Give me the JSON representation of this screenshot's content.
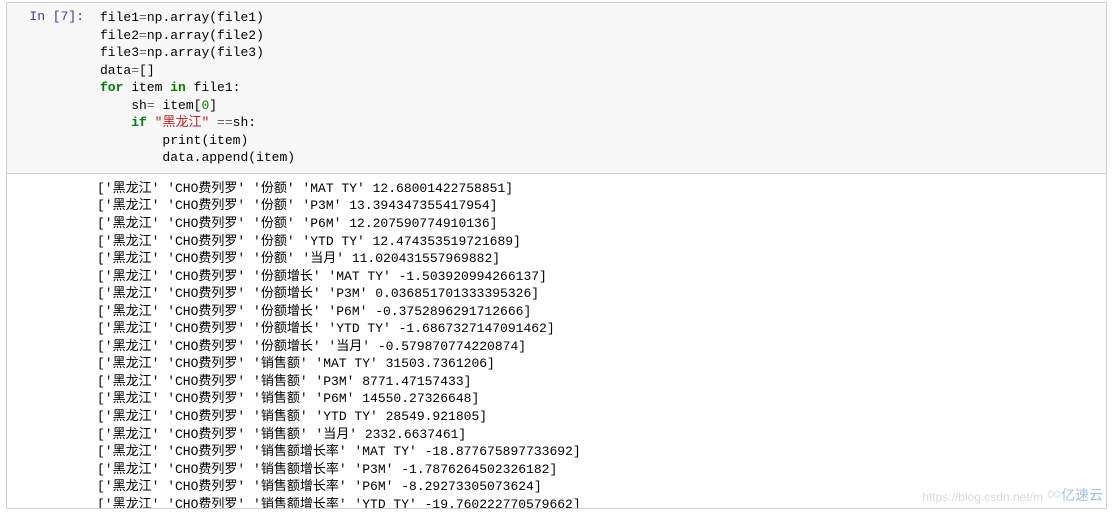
{
  "cell": {
    "prompt_label": "In  [7]:",
    "code_lines": [
      {
        "tokens": [
          {
            "t": "file1",
            "c": "var"
          },
          {
            "t": "=",
            "c": "op"
          },
          {
            "t": "np",
            "c": "var"
          },
          {
            "t": ".",
            "c": "var"
          },
          {
            "t": "array",
            "c": "var"
          },
          {
            "t": "(",
            "c": "paren"
          },
          {
            "t": "file1",
            "c": "var"
          },
          {
            "t": ")",
            "c": "paren"
          }
        ],
        "indent": 0
      },
      {
        "tokens": [
          {
            "t": "file2",
            "c": "var"
          },
          {
            "t": "=",
            "c": "op"
          },
          {
            "t": "np",
            "c": "var"
          },
          {
            "t": ".",
            "c": "var"
          },
          {
            "t": "array",
            "c": "var"
          },
          {
            "t": "(",
            "c": "paren"
          },
          {
            "t": "file2",
            "c": "var"
          },
          {
            "t": ")",
            "c": "paren"
          }
        ],
        "indent": 0
      },
      {
        "tokens": [
          {
            "t": "file3",
            "c": "var"
          },
          {
            "t": "=",
            "c": "op"
          },
          {
            "t": "np",
            "c": "var"
          },
          {
            "t": ".",
            "c": "var"
          },
          {
            "t": "array",
            "c": "var"
          },
          {
            "t": "(",
            "c": "paren"
          },
          {
            "t": "file3",
            "c": "var"
          },
          {
            "t": ")",
            "c": "paren"
          }
        ],
        "indent": 0
      },
      {
        "tokens": [
          {
            "t": "data",
            "c": "var"
          },
          {
            "t": "=",
            "c": "op"
          },
          {
            "t": "[]",
            "c": "paren"
          }
        ],
        "indent": 0
      },
      {
        "tokens": [
          {
            "t": "for",
            "c": "kw-green"
          },
          {
            "t": " item ",
            "c": "var"
          },
          {
            "t": "in",
            "c": "kw-green"
          },
          {
            "t": " file1:",
            "c": "var"
          }
        ],
        "indent": 0
      },
      {
        "tokens": [
          {
            "t": "sh",
            "c": "var"
          },
          {
            "t": "= ",
            "c": "op"
          },
          {
            "t": "item",
            "c": "var"
          },
          {
            "t": "[",
            "c": "paren"
          },
          {
            "t": "0",
            "c": "num"
          },
          {
            "t": "]",
            "c": "paren"
          }
        ],
        "indent": 1
      },
      {
        "tokens": [
          {
            "t": "if",
            "c": "kw-green"
          },
          {
            "t": " ",
            "c": "var"
          },
          {
            "t": "\"黑龙江\"",
            "c": "kw-red"
          },
          {
            "t": " ==",
            "c": "op"
          },
          {
            "t": "sh:",
            "c": "var"
          }
        ],
        "indent": 1
      },
      {
        "tokens": [
          {
            "t": "print",
            "c": "var"
          },
          {
            "t": "(",
            "c": "paren"
          },
          {
            "t": "item",
            "c": "var"
          },
          {
            "t": ")",
            "c": "paren"
          }
        ],
        "indent": 2
      },
      {
        "tokens": [
          {
            "t": "data",
            "c": "var"
          },
          {
            "t": ".",
            "c": "var"
          },
          {
            "t": "append",
            "c": "var"
          },
          {
            "t": "(",
            "c": "paren"
          },
          {
            "t": "item",
            "c": "var"
          },
          {
            "t": ")",
            "c": "paren"
          }
        ],
        "indent": 2
      }
    ]
  },
  "output_lines": [
    "['黑龙江' 'CHO费列罗' '份额' 'MAT TY' 12.68001422758851]",
    "['黑龙江' 'CHO费列罗' '份额' 'P3M' 13.394347355417954]",
    "['黑龙江' 'CHO费列罗' '份额' 'P6M' 12.207590774910136]",
    "['黑龙江' 'CHO费列罗' '份额' 'YTD TY' 12.474353519721689]",
    "['黑龙江' 'CHO费列罗' '份额' '当月' 11.020431557969882]",
    "['黑龙江' 'CHO费列罗' '份额增长' 'MAT TY' -1.503920994266137]",
    "['黑龙江' 'CHO费列罗' '份额增长' 'P3M' 0.036851701333395326]",
    "['黑龙江' 'CHO费列罗' '份额增长' 'P6M' -0.3752896291712666]",
    "['黑龙江' 'CHO费列罗' '份额增长' 'YTD TY' -1.6867327147091462]",
    "['黑龙江' 'CHO费列罗' '份额增长' '当月' -0.579870774220874]",
    "['黑龙江' 'CHO费列罗' '销售额' 'MAT TY' 31503.7361206]",
    "['黑龙江' 'CHO费列罗' '销售额' 'P3M' 8771.47157433]",
    "['黑龙江' 'CHO费列罗' '销售额' 'P6M' 14550.27326648]",
    "['黑龙江' 'CHO费列罗' '销售额' 'YTD TY' 28549.921805]",
    "['黑龙江' 'CHO费列罗' '销售额' '当月' 2332.6637461]",
    "['黑龙江' 'CHO费列罗' '销售额增长率' 'MAT TY' -18.877675897733692]",
    "['黑龙江' 'CHO费列罗' '销售额增长率' 'P3M' -1.7876264502326182]",
    "['黑龙江' 'CHO费列罗' '销售额增长率' 'P6M' -8.29273305073624]",
    "['黑龙江' 'CHO费列罗' '销售额增长率' 'YTD TY' -19.760222770579662]"
  ],
  "watermark_text": "https://blog.csdn.net/m",
  "logo_text": "亿速云"
}
